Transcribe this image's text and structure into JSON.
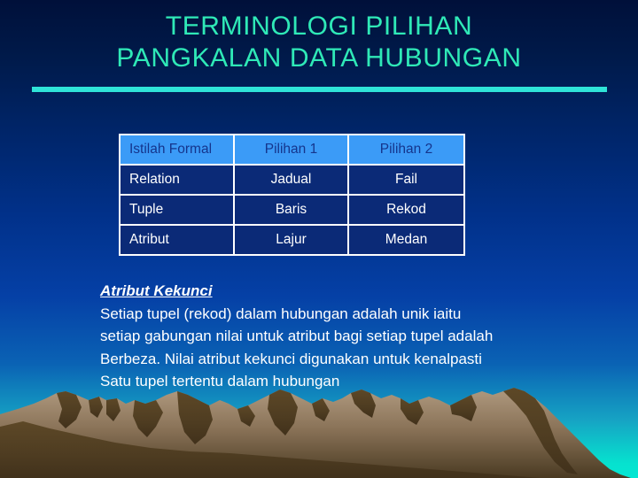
{
  "slide": {
    "title_line_1": "TERMINOLOGI PILIHAN",
    "title_line_2": "PANGKALAN DATA HUBUNGAN",
    "title": "TERMINOLOGI PILIHAN\nPANGKALAN DATA HUBUNGAN"
  },
  "colors": {
    "title_text": "#2fe9b7",
    "rule": "#2fe4d8",
    "table_header_bg": "#3b9bf7",
    "table_header_text": "#15358c",
    "table_body_bg": "#0b2a77",
    "table_body_text": "#ffffff",
    "table_border": "#ffffff",
    "body_text": "#ffffff",
    "background_top": "#00103a",
    "background_bottom": "#04e6d2",
    "mountain_light": "#a08a6e",
    "mountain_dark": "#4a3a22"
  },
  "table": {
    "headers": [
      "Istilah Formal",
      "Pilihan 1",
      "Pilihan 2"
    ],
    "rows": [
      [
        "Relation",
        "Jadual",
        "Fail"
      ],
      [
        "Tuple",
        "Baris",
        "Rekod"
      ],
      [
        "Atribut",
        "Lajur",
        "Medan"
      ]
    ]
  },
  "body": {
    "heading": "Atribut Kekunci",
    "lines": [
      "Setiap tupel (rekod) dalam hubungan adalah unik iaitu",
      "setiap gabungan nilai untuk atribut bagi setiap tupel adalah",
      "Berbeza. Nilai atribut kekunci digunakan untuk kenalpasti",
      "Satu tupel tertentu dalam hubungan"
    ]
  },
  "decoration": {
    "scene_name": "mountain-range-silhouette"
  }
}
